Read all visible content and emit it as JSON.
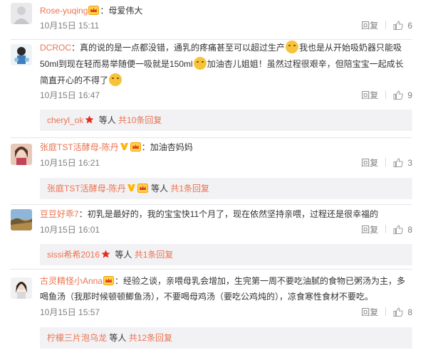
{
  "comments": [
    {
      "user": "Rose-yuqing",
      "sep": "：",
      "text": "母爱伟大",
      "time": "10月15日 15:11",
      "reply_label": "回复",
      "likes": "6"
    },
    {
      "user": "DCROC",
      "sep": "：",
      "text_a": "真的说的是一点都没错，通乳的疼痛甚至可以超过生产",
      "text_b": "我也是从开始吸奶器只能吸",
      "text_c": "50ml到现在轻而易举随便一吸就是150ml",
      "text_d": "加油杏儿姐姐！虽然过程很艰辛，但陪宝宝一起成长",
      "text_e": "简直开心的不得了",
      "time": "10月15日 16:47",
      "reply_label": "回复",
      "likes": "9",
      "replies_user": "cheryl_ok",
      "replies_mid": " 等人 ",
      "replies_link": "共10条回复"
    },
    {
      "user": "张庭TST活酵母-陈丹",
      "sep": "：",
      "text": "加油杏妈妈",
      "time": "10月15日 16:21",
      "reply_label": "回复",
      "likes": "3",
      "replies_user": "张庭TST活酵母-陈丹",
      "replies_mid": " 等人 ",
      "replies_link": "共1条回复"
    },
    {
      "user": "豆豆好乖7",
      "sep": "：",
      "text": "初乳是最好的，我的宝宝快11个月了，现在依然坚持亲喂，过程还是很幸福的",
      "time": "10月15日 16:01",
      "reply_label": "回复",
      "likes": "8",
      "replies_user": "sissi希希2016",
      "replies_mid": " 等人 ",
      "replies_link": "共1条回复"
    },
    {
      "user": "古灵精怪小Anna",
      "sep": "：",
      "text_a": "经验之谈，亲喂母乳会增加，生完第一周不要吃油腻的食物已粥汤为主，多",
      "text_b": "喝鱼汤（我那时候顿顿鲫鱼汤），不要喝母鸡汤（要吃公鸡炖的），凉食寒性食材不要吃。",
      "time": "10月15日 15:57",
      "reply_label": "回复",
      "likes": "8",
      "replies_user": "柠檬三片泡乌龙",
      "replies_mid": " 等人 ",
      "replies_link": "共12条回复"
    }
  ],
  "colors": {
    "accent": "#eb7350",
    "meta": "#808080",
    "reply_bg": "#f2f2f5"
  }
}
